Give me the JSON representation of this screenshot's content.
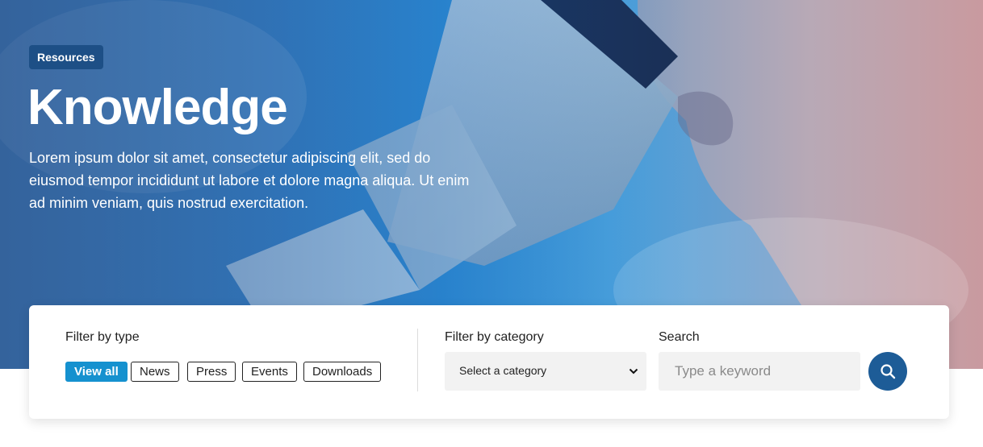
{
  "hero": {
    "badge": "Resources",
    "title": "Knowledge",
    "description": "Lorem ipsum dolor sit amet, consectetur adipiscing elit, sed do eiusmod tempor incididunt ut labore et dolore magna aliqua. Ut enim ad minim veniam, quis nostrud exercitation."
  },
  "filters": {
    "type_label": "Filter by type",
    "types": [
      {
        "label": "View all",
        "active": true
      },
      {
        "label": "News",
        "active": false
      },
      {
        "label": "Press",
        "active": false
      },
      {
        "label": "Events",
        "active": false
      },
      {
        "label": "Downloads",
        "active": false
      }
    ],
    "category_label": "Filter by category",
    "category_selected": "Select a category",
    "search_label": "Search",
    "search_placeholder": "Type a keyword"
  },
  "icons": {
    "dropdown": "chevron-down-icon",
    "search": "search-icon"
  },
  "colors": {
    "accent": "#1591cf",
    "brand_dark": "#1d4f86",
    "search_button": "#1d5c97"
  }
}
